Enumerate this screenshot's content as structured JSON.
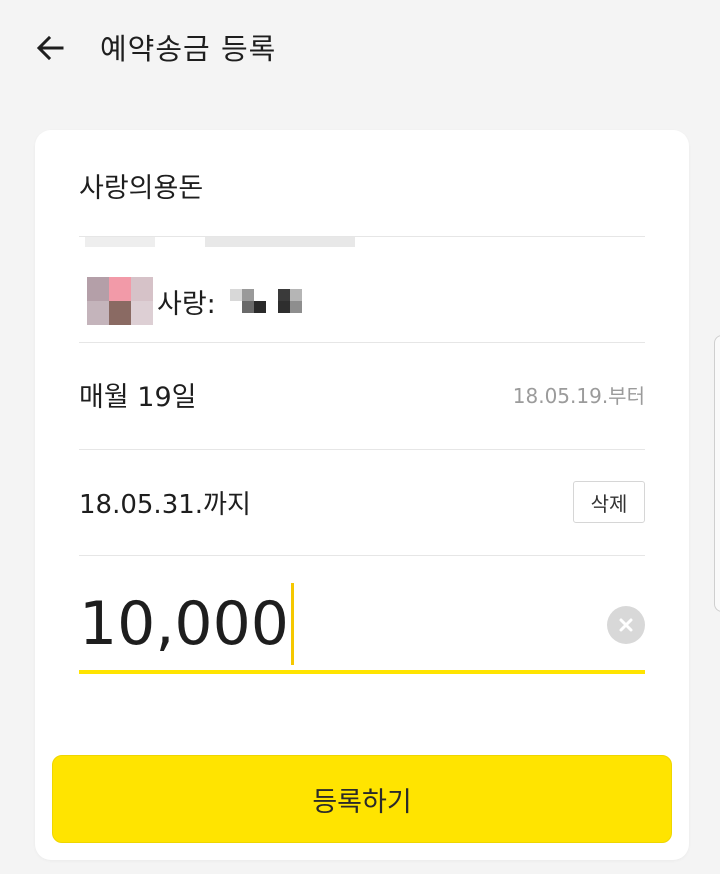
{
  "header": {
    "title": "예약송금 등록",
    "back_icon": "arrow-left-icon"
  },
  "form": {
    "account_alias": "사랑의용돈",
    "recipient": {
      "name": "사랑:"
    },
    "schedule": {
      "label": "매월 19일",
      "start_date": "18.05.19.부터"
    },
    "end_date": {
      "label": "18.05.31.까지",
      "delete_label": "삭제"
    },
    "amount": {
      "value": "10,000",
      "clear_icon": "clear-x-icon"
    },
    "submit_label": "등록하기"
  },
  "colors": {
    "accent": "#ffe400",
    "background": "#f4f4f4",
    "card": "#ffffff",
    "muted_text": "#9b9b9b"
  }
}
